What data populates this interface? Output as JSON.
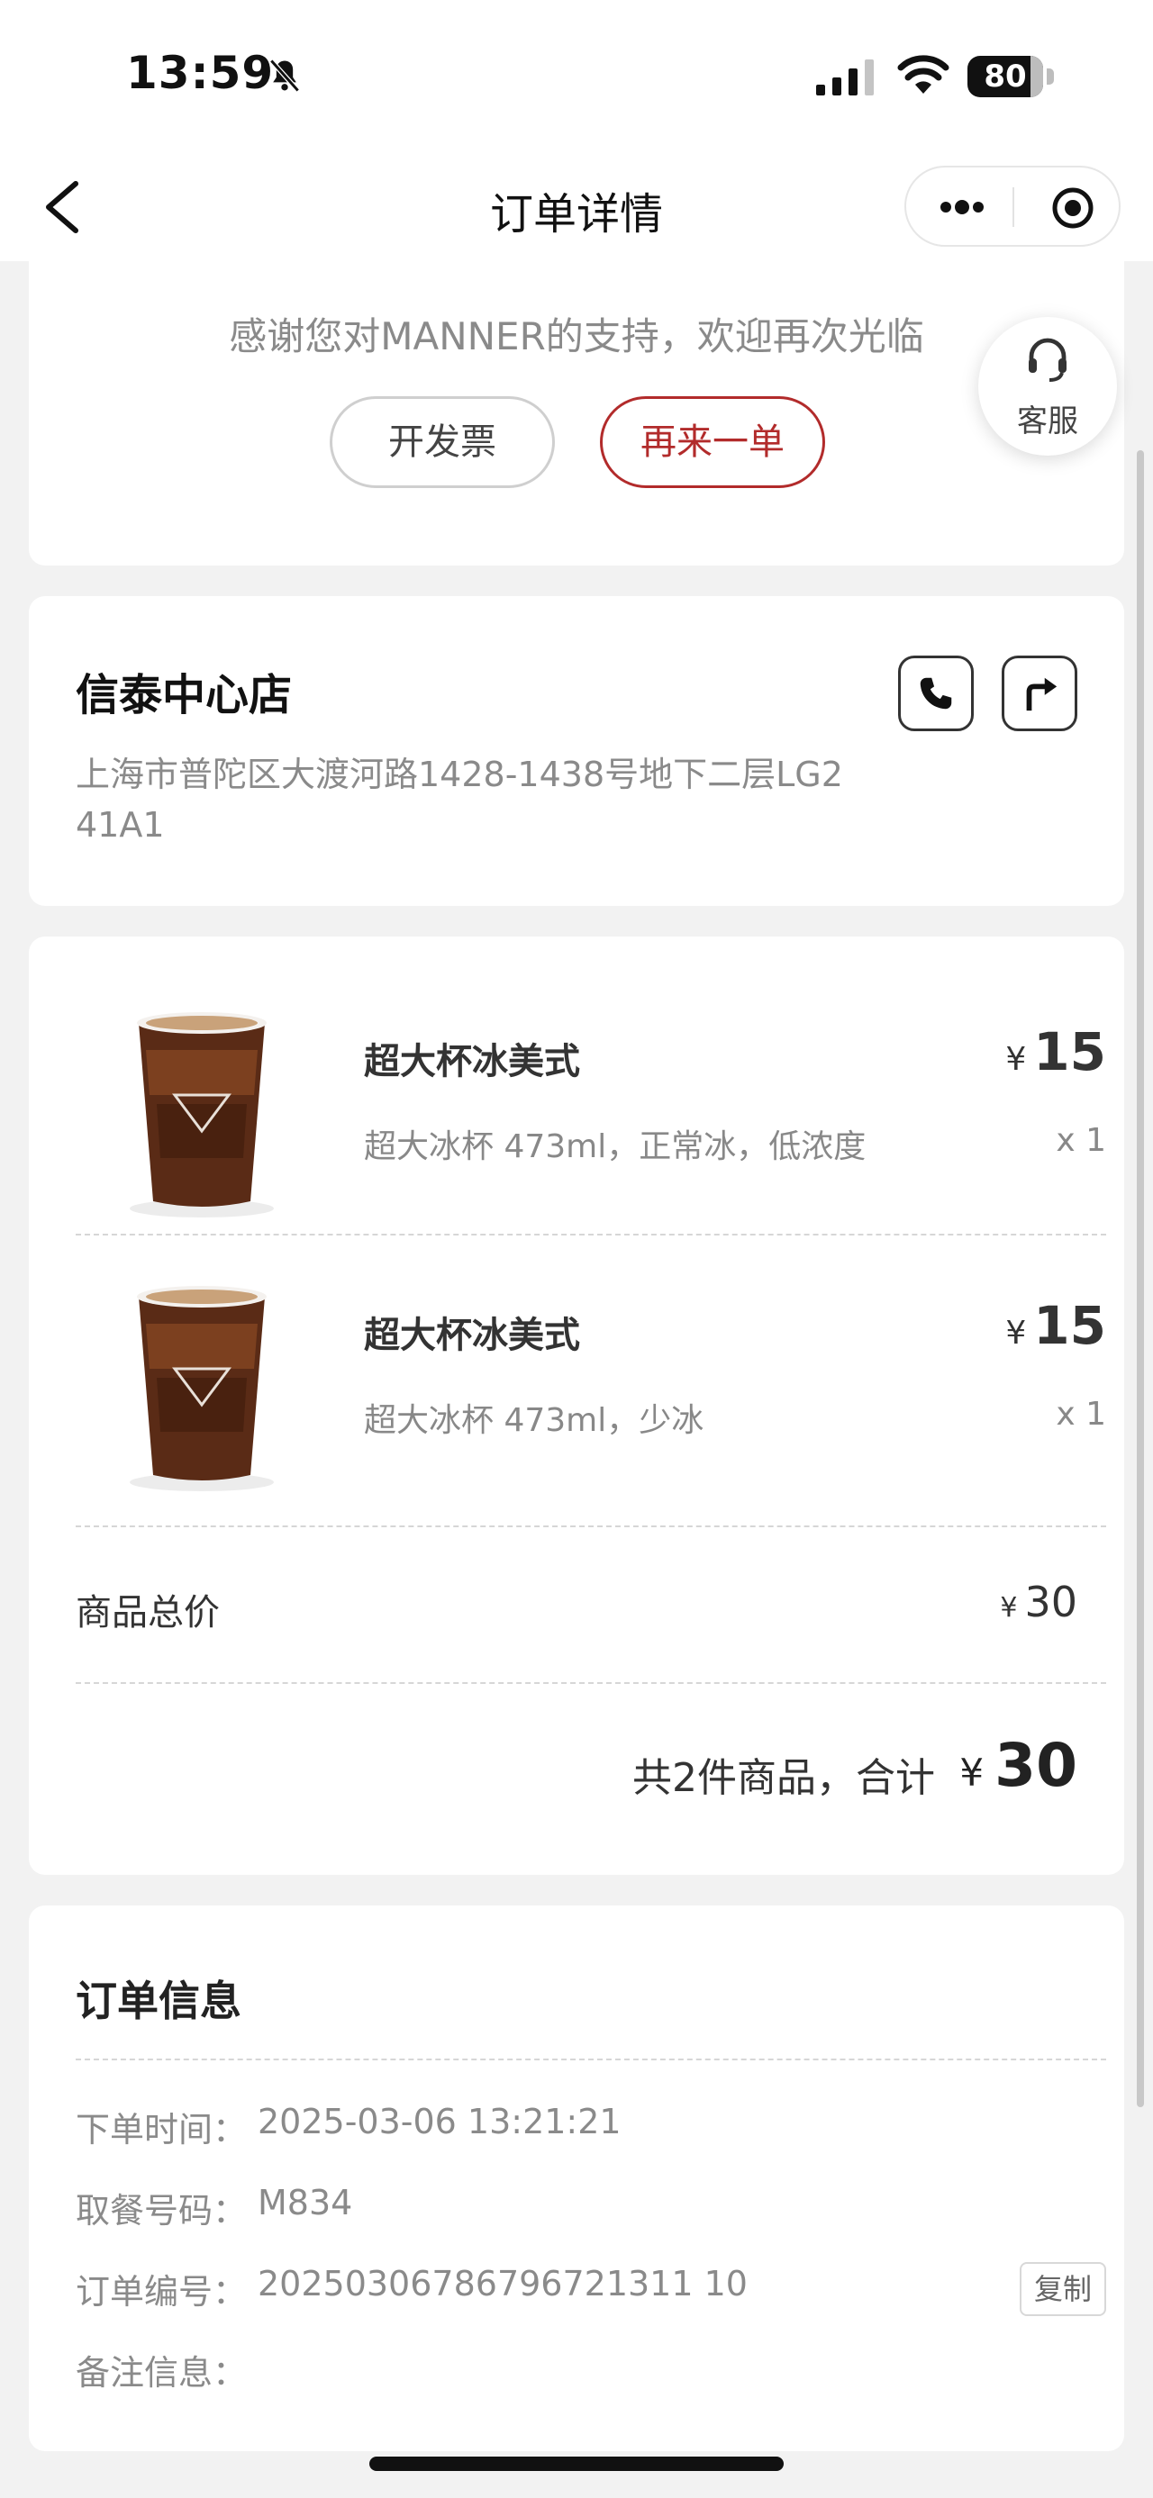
{
  "status_bar": {
    "time": "13:59",
    "battery": "80"
  },
  "nav": {
    "title": "订单详情"
  },
  "top_card": {
    "thanks": "感谢您对MANNER的支持，欢迎再次光临",
    "invoice_label": "开发票",
    "reorder_label": "再来一单"
  },
  "service": {
    "label": "客服"
  },
  "store": {
    "name": "信泰中心店",
    "address": "上海市普陀区大渡河路1428-1438号地下二层LG2 41A1"
  },
  "items": [
    {
      "name": "超大杯冰美式",
      "spec": "超大冰杯 473ml，正常冰，低浓度",
      "currency": "¥",
      "price": "15",
      "qty": "x 1"
    },
    {
      "name": "超大杯冰美式",
      "spec": "超大冰杯 473ml，少冰",
      "currency": "¥",
      "price": "15",
      "qty": "x 1"
    }
  ],
  "summary": {
    "subtotal_label": "商品总价",
    "currency": "¥",
    "subtotal": "30",
    "total_text": "共2件商品，合计",
    "total": "30"
  },
  "order_info": {
    "title": "订单信息",
    "rows": [
      {
        "label": "下单时间：",
        "value": "2025-03-06 13:21:21"
      },
      {
        "label": "取餐号码：",
        "value": "M834"
      },
      {
        "label": "订单编号：",
        "value": "20250306786796721311 10"
      },
      {
        "label": "备注信息：",
        "value": ""
      }
    ],
    "copy_label": "复制"
  },
  "colors": {
    "accent": "#b22b2b",
    "background": "#f2f2f2"
  }
}
